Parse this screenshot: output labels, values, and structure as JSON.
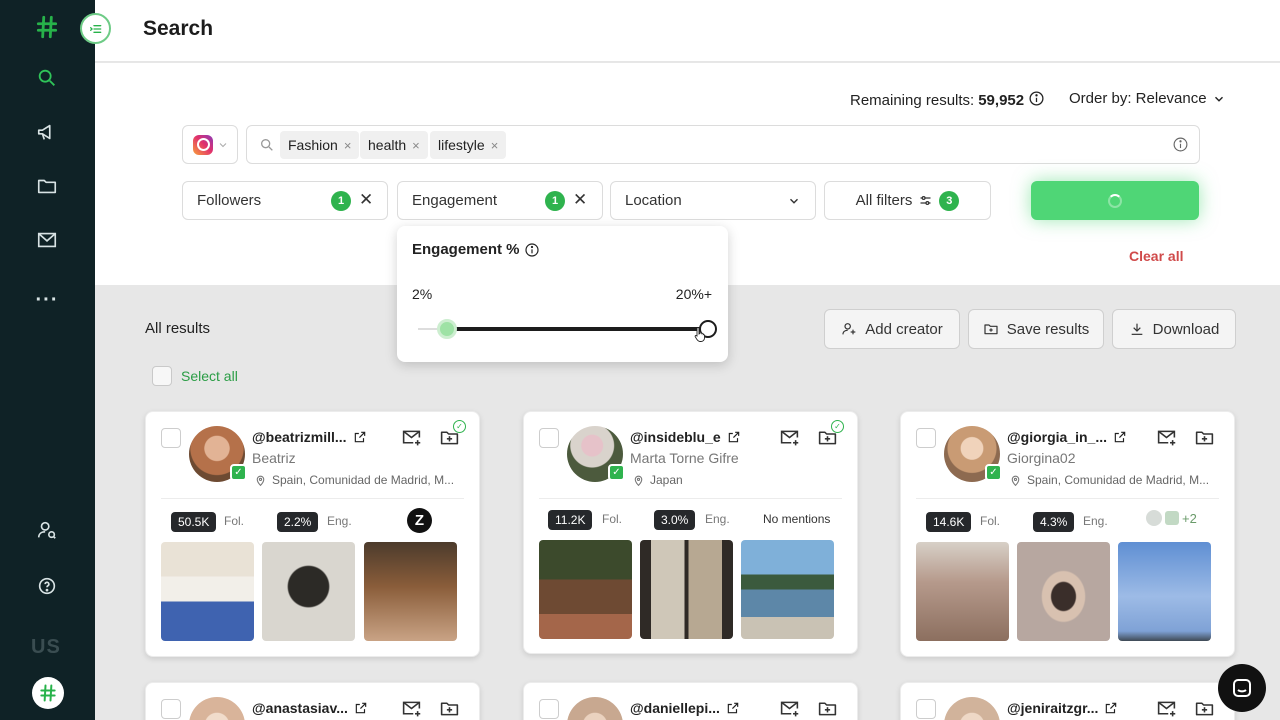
{
  "sidebar": {
    "region": "US",
    "icons": [
      "hash-logo-icon",
      "search-icon",
      "megaphone-icon",
      "folder-icon",
      "mail-icon",
      "more-icon",
      "user-search-icon",
      "help-icon",
      "avatar-logo-icon"
    ],
    "more_label": "···"
  },
  "header": {
    "title": "Search"
  },
  "results_meta": {
    "remaining_label": "Remaining results:",
    "remaining_value": "59,952",
    "order_by": "Order by: Relevance"
  },
  "search": {
    "platform": "instagram",
    "chips": [
      {
        "label": "Fashion"
      },
      {
        "label": "health"
      },
      {
        "label": "lifestyle"
      }
    ],
    "chip_close": "×"
  },
  "filters": {
    "followers": {
      "label": "Followers",
      "count": "1"
    },
    "engagement": {
      "label": "Engagement",
      "count": "1"
    },
    "location": {
      "label": "Location"
    },
    "all_filters": {
      "label": "All filters",
      "count": "3"
    },
    "clear_all": "Clear all"
  },
  "engagement_popover": {
    "title": "Engagement %",
    "min_label": "2%",
    "max_label": "20%+",
    "range_min": 0,
    "range_max": 20,
    "value_min": 2,
    "value_max": 20
  },
  "results": {
    "title": "All results",
    "select_all": "Select all",
    "buttons": {
      "add_creator": "Add creator",
      "save_results": "Save results",
      "download": "Download"
    }
  },
  "cards": [
    {
      "handle": "@beatrizmill...",
      "name": "Beatriz",
      "location": "Spain, Comunidad de Madrid, M...",
      "followers": "50.5K",
      "fol_label": "Fol.",
      "engagement": "2.2%",
      "eng_label": "Eng.",
      "brand": "Z",
      "saved": true,
      "avatar_color": "#b5714a",
      "thumbs": [
        "#3f63b0",
        "#d9d6cf",
        "#8a5d3a"
      ]
    },
    {
      "handle": "@insideblu_e",
      "name": "Marta Torne Gifre",
      "location": "Japan",
      "followers": "11.2K",
      "fol_label": "Fol.",
      "engagement": "3.0%",
      "eng_label": "Eng.",
      "mentions": "No mentions",
      "saved": true,
      "avatar_color": "#4c5a3d",
      "thumbs": [
        "#6e4a33",
        "#2f2a26",
        "#5d87a8"
      ]
    },
    {
      "handle": "@giorgia_in_...",
      "name": "Giorgina02",
      "location": "Spain, Comunidad de Madrid, M...",
      "followers": "14.6K",
      "fol_label": "Fol.",
      "engagement": "4.3%",
      "eng_label": "Eng.",
      "brands_more": "+2",
      "saved": false,
      "avatar_color": "#c99b74",
      "thumbs": [
        "#b69a8c",
        "#b7a7a0",
        "#7fa2d6"
      ]
    },
    {
      "handle": "@anastasiav...",
      "avatar_color": "#d9b49a"
    },
    {
      "handle": "@daniellepi...",
      "avatar_color": "#c8a890"
    },
    {
      "handle": "@jeniraitzgr...",
      "avatar_color": "#d1b39b"
    }
  ],
  "colors": {
    "sidebar_bg": "#0f2226",
    "accent_green": "#2fb34e",
    "clear_red": "#d04a4a",
    "search_button": "#4fd676"
  }
}
